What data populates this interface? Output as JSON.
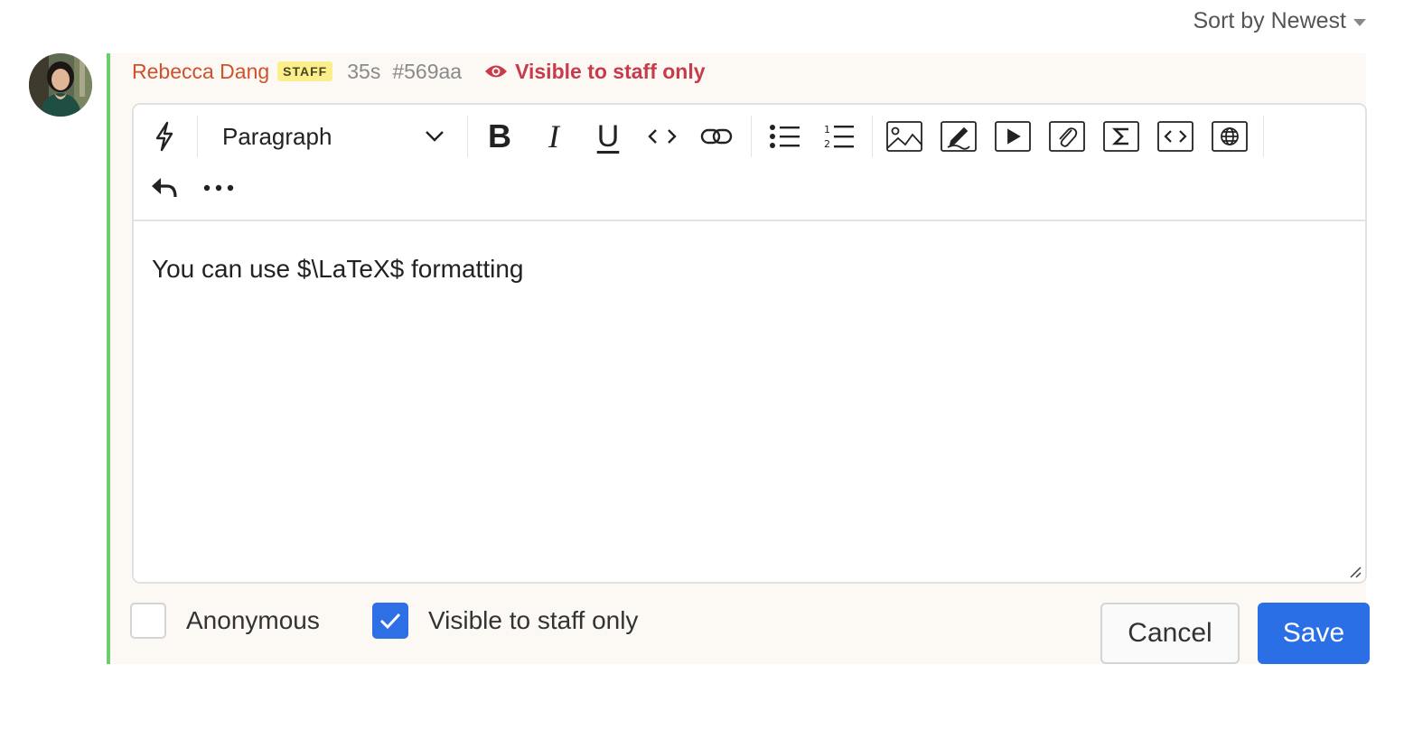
{
  "sort": {
    "label": "Sort by Newest"
  },
  "comment": {
    "author": "Rebecca Dang",
    "badge": "STAFF",
    "time": "35s",
    "id": "#569aa",
    "visibility": "Visible to staff only",
    "colors": {
      "accent_bar": "#6ccd6f",
      "author": "#d1512b",
      "visibility": "#c73b4a",
      "primary": "#2a6fe6"
    }
  },
  "editor": {
    "paragraph_select": "Paragraph",
    "content": "You can use $\\LaTeX$ formatting",
    "toolbar_icons": [
      "lightning-icon",
      "bold",
      "italic",
      "underline",
      "code-icon",
      "link-icon",
      "bullet-list-icon",
      "numbered-list-icon",
      "image-icon",
      "draw-icon",
      "video-icon",
      "attachment-icon",
      "sigma-icon",
      "embed-code-icon",
      "globe-icon",
      "undo-icon",
      "more-icon"
    ],
    "bold_glyph": "B",
    "italic_glyph": "I",
    "underline_glyph": "U"
  },
  "options": {
    "anonymous_label": "Anonymous",
    "anonymous_checked": false,
    "staff_only_label": "Visible to staff only",
    "staff_only_checked": true
  },
  "buttons": {
    "cancel": "Cancel",
    "save": "Save"
  }
}
